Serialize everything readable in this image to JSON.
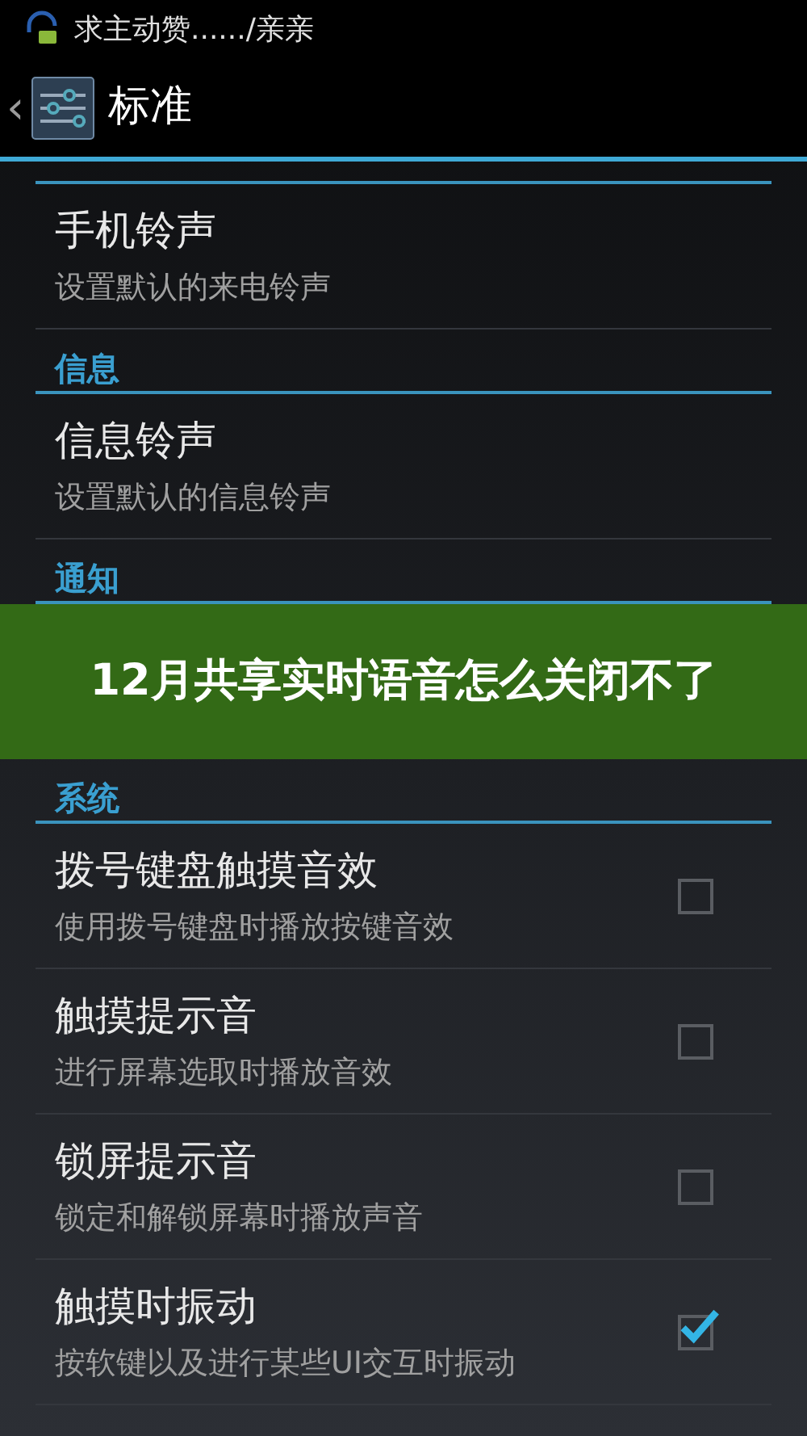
{
  "status_bar": {
    "notification": "求主动赞....../亲亲"
  },
  "action_bar": {
    "back": "‹",
    "title": "标准"
  },
  "blocks": [
    {
      "kind": "section",
      "items": [
        {
          "kind": "plain",
          "title": "手机铃声",
          "subtitle": "设置默认的来电铃声"
        }
      ]
    },
    {
      "kind": "section",
      "header": "信息",
      "items": [
        {
          "kind": "plain",
          "title": "信息铃声",
          "subtitle": "设置默认的信息铃声"
        }
      ]
    },
    {
      "kind": "section",
      "header": "通知"
    },
    {
      "kind": "banner",
      "title": "12月共享实时语音怎么关闭不了"
    },
    {
      "kind": "section",
      "header": "系统",
      "items": [
        {
          "kind": "checkbox",
          "title": "拨号键盘触摸音效",
          "subtitle": "使用拨号键盘时播放按键音效",
          "checked": false
        },
        {
          "kind": "checkbox",
          "title": "触摸提示音",
          "subtitle": "进行屏幕选取时播放音效",
          "checked": false
        },
        {
          "kind": "checkbox",
          "title": "锁屏提示音",
          "subtitle": "锁定和解锁屏幕时播放声音",
          "checked": false
        },
        {
          "kind": "checkbox",
          "title": "触摸时振动",
          "subtitle": "按软键以及进行某些UI交互时振动",
          "checked": true
        }
      ]
    }
  ]
}
